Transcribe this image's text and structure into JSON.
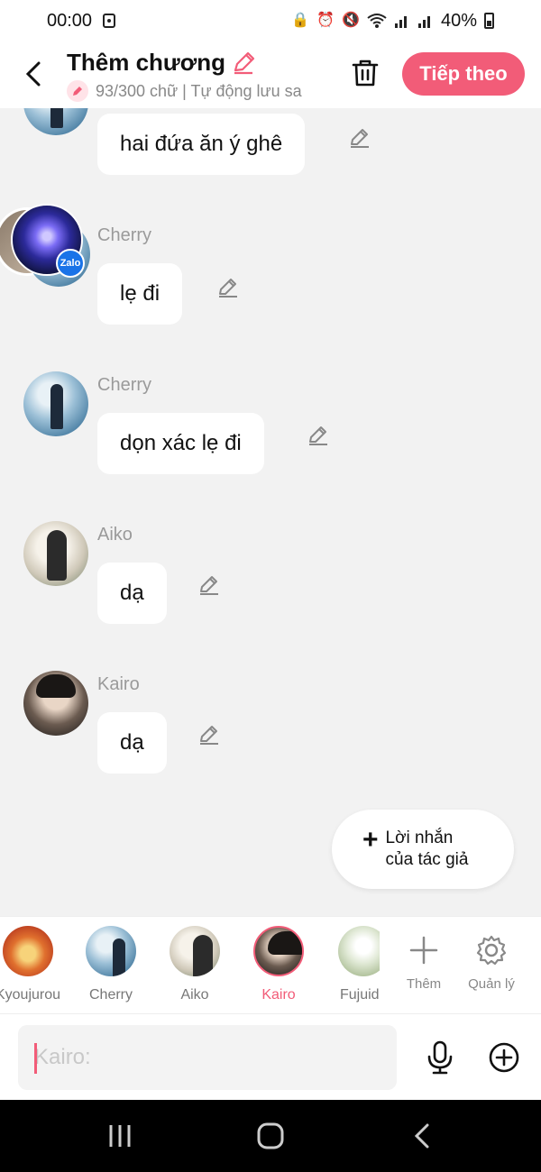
{
  "status_bar": {
    "time": "00:00",
    "battery": "40%"
  },
  "header": {
    "title": "Thêm chương",
    "subtitle": "93/300 chữ | Tự động lưu sa",
    "next_label": "Tiếp theo"
  },
  "messages": [
    {
      "sender": "",
      "text": "hai đứa ăn ý ghê"
    },
    {
      "sender": "Cherry",
      "text": "lẹ đi",
      "badge": "Zalo"
    },
    {
      "sender": "Cherry",
      "text": "dọn xác lẹ đi"
    },
    {
      "sender": "Aiko",
      "text": "dạ"
    },
    {
      "sender": "Kairo",
      "text": "dạ"
    }
  ],
  "author_note": {
    "line1": "Lời nhắn",
    "line2": "của tác giả"
  },
  "characters": [
    {
      "name": "Kyoujurou"
    },
    {
      "name": "Cherry"
    },
    {
      "name": "Aiko"
    },
    {
      "name": "Kairo",
      "active": true
    },
    {
      "name": "Fujuida"
    }
  ],
  "tools": {
    "add_label": "Thêm",
    "manage_label": "Quản lý"
  },
  "input": {
    "placeholder": "Kairo:"
  },
  "colors": {
    "accent": "#f25c78",
    "background": "#f2f2f2"
  }
}
